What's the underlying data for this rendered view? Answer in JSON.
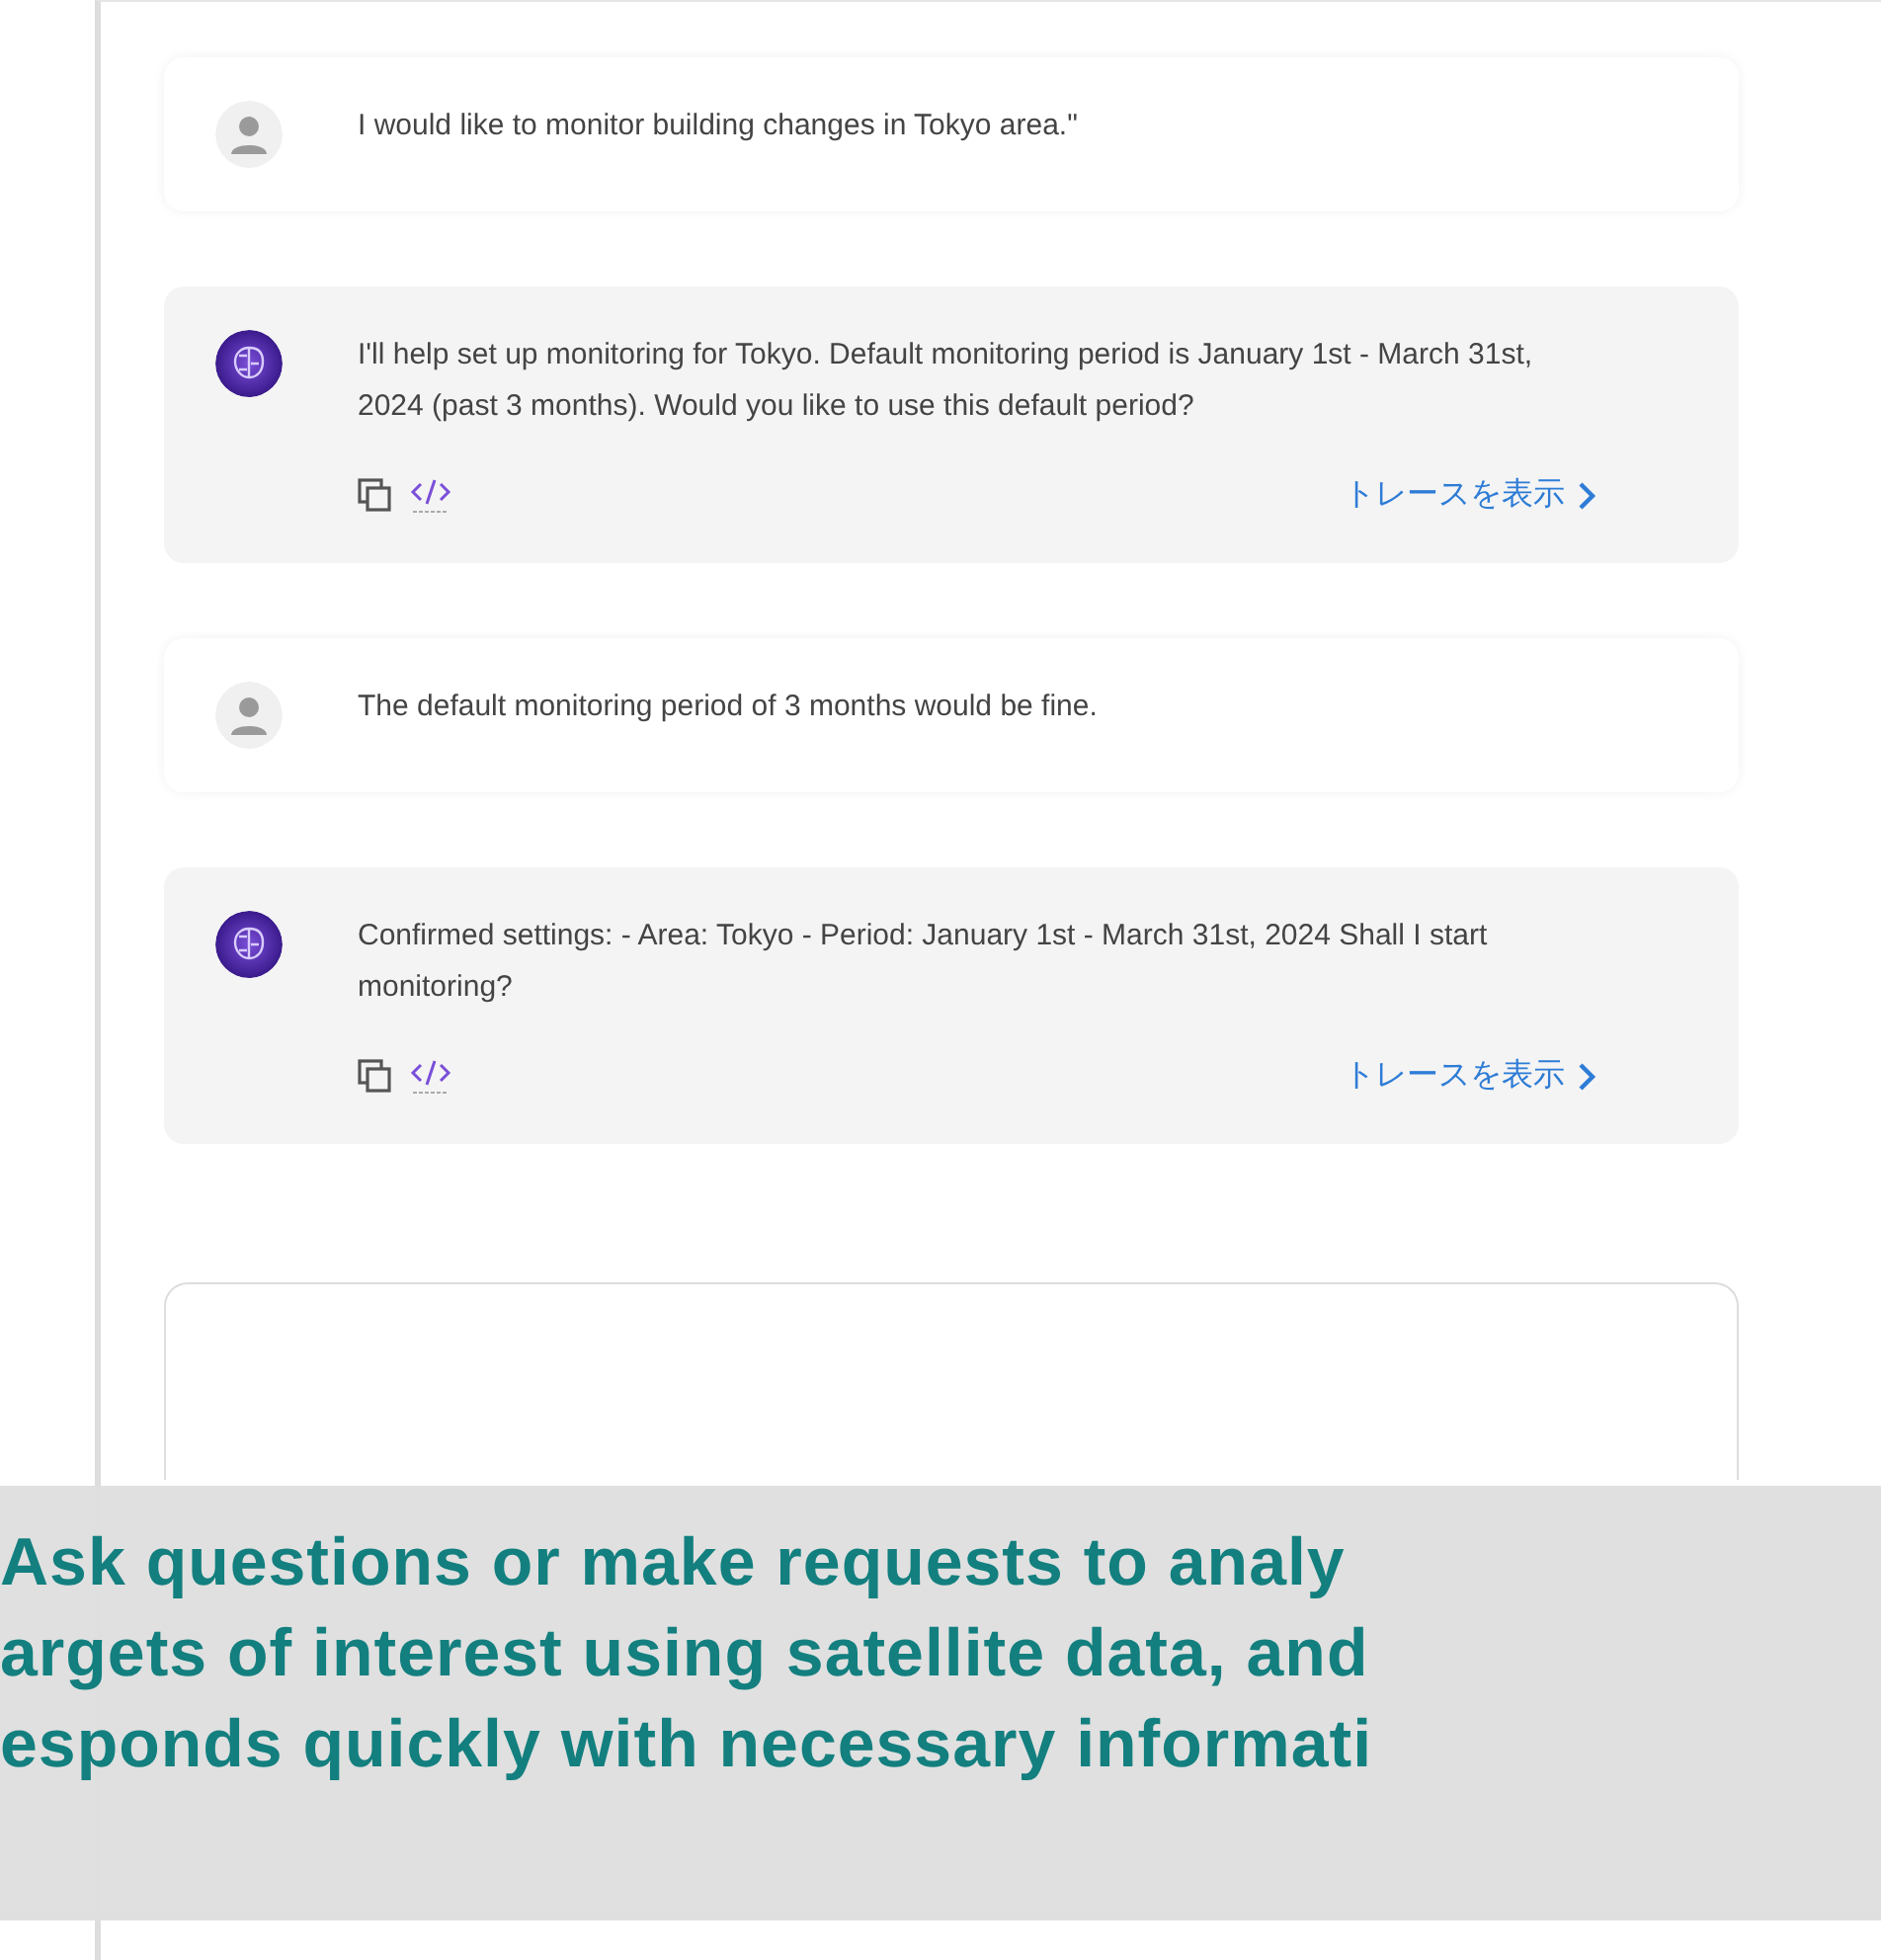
{
  "messages": [
    {
      "kind": "user",
      "text": "I would like to monitor building changes in Tokyo area.\""
    },
    {
      "kind": "assistant",
      "text": "I'll help set up monitoring for Tokyo. Default monitoring period is January 1st - March 31st, 2024 (past 3 months). Would you like to use this default period?",
      "trace_link": "トレースを表示"
    },
    {
      "kind": "user",
      "text": "The default monitoring period of 3 months would be fine."
    },
    {
      "kind": "assistant",
      "text": "Confirmed settings: - Area: Tokyo - Period: January 1st - March 31st, 2024 Shall I start monitoring?",
      "trace_link": "トレースを表示"
    }
  ],
  "caption": {
    "lines": [
      "Ask questions or make requests to analy",
      "argets of interest using satellite data, and",
      "esponds quickly with necessary informati"
    ]
  }
}
